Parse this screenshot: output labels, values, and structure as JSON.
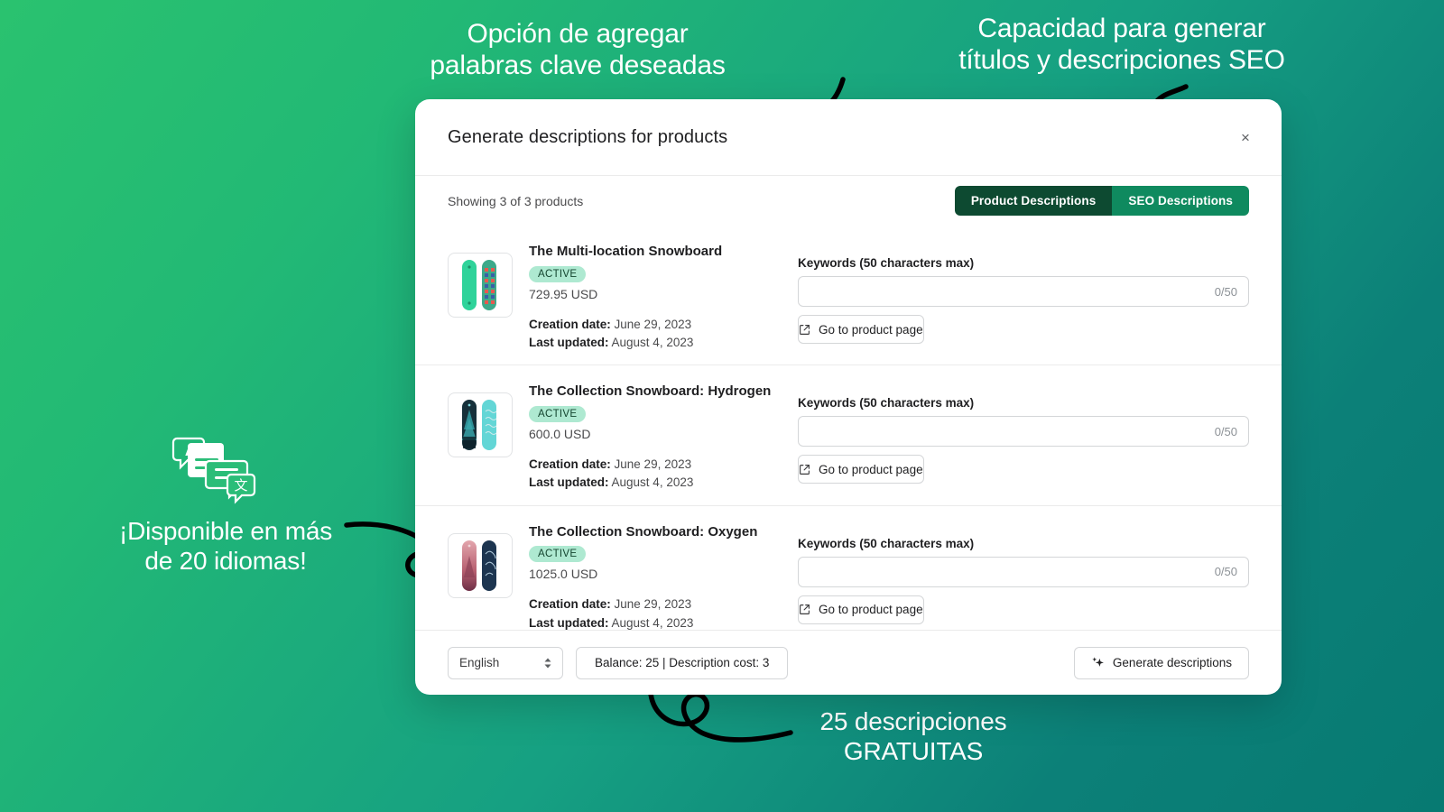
{
  "background": {
    "from": "#2ac26f",
    "to": "#077a72"
  },
  "promos": {
    "keywords": "Opción de agregar\npalabras clave deseadas",
    "seo": "Capacidad para generar\ntítulos y descripciones SEO",
    "languages": "¡Disponible en más\nde 20 idiomas!",
    "free": "25 descripciones\nGRATUITAS"
  },
  "modal": {
    "title": "Generate descriptions for products",
    "close_label": "×",
    "showing_text": "Showing 3 of 3 products",
    "tabs": [
      {
        "label": "Product Descriptions",
        "active": false,
        "color": "#0d4a31"
      },
      {
        "label": "SEO Descriptions",
        "active": true,
        "color": "#0f8a5f"
      }
    ],
    "keywords_label": "Keywords (50 characters max)",
    "keywords_value": "",
    "keywords_placeholder": "",
    "keywords_counter": "0/50",
    "go_to_product_label": "Go to product page",
    "creation_date_label": "Creation date:",
    "last_updated_label": "Last updated:",
    "products": [
      {
        "name": "The Multi-location Snowboard",
        "status": "ACTIVE",
        "price": "729.95 USD",
        "creation_date": "June 29, 2023",
        "last_updated": "August 4, 2023",
        "thumb_colors": [
          "#2fd39a",
          "#3da98a"
        ]
      },
      {
        "name": "The Collection Snowboard: Hydrogen",
        "status": "ACTIVE",
        "price": "600.0 USD",
        "creation_date": "June 29, 2023",
        "last_updated": "August 4, 2023",
        "thumb_colors": [
          "#16303a",
          "#63d6d6"
        ]
      },
      {
        "name": "The Collection Snowboard: Oxygen",
        "status": "ACTIVE",
        "price": "1025.0 USD",
        "creation_date": "June 29, 2023",
        "last_updated": "August 4, 2023",
        "thumb_colors": [
          "#c4707c",
          "#1d3550"
        ]
      }
    ],
    "footer": {
      "language_value": "English",
      "balance_label": "Balance: 25 | Description cost: 3",
      "generate_label": "Generate descriptions"
    }
  }
}
